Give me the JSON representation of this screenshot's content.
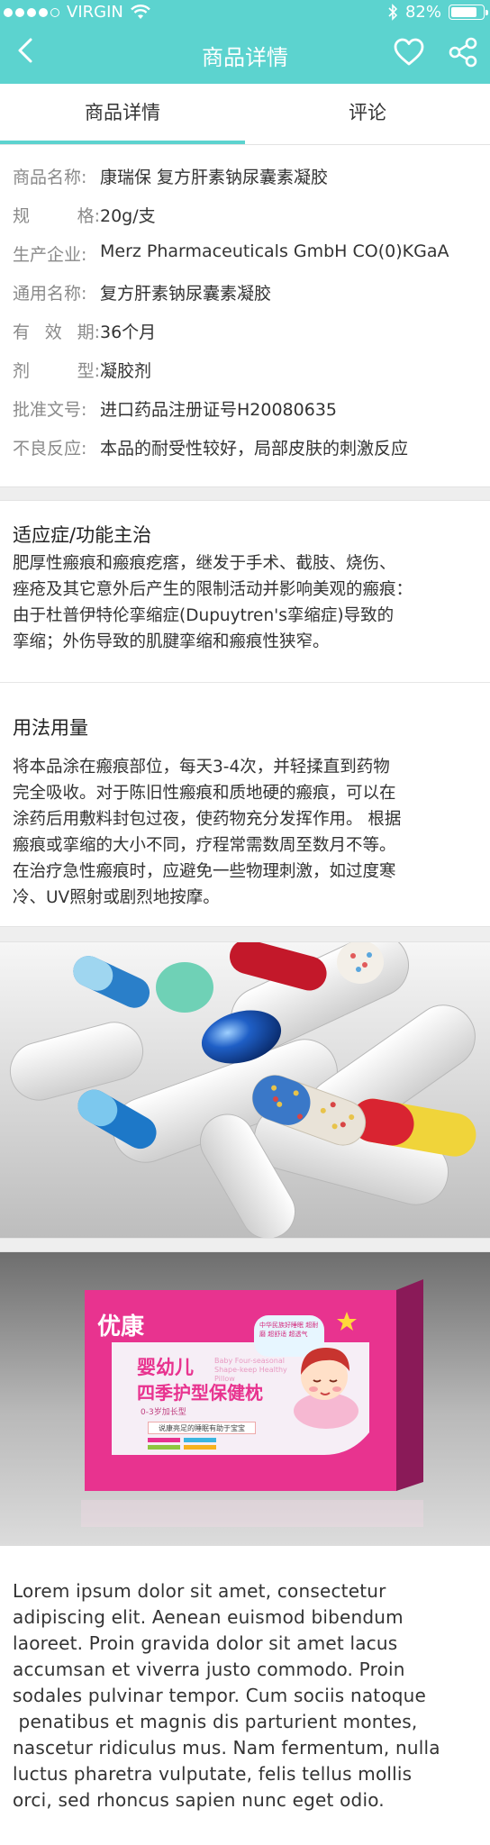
{
  "status_bar": {
    "carrier": "VIRGIN",
    "battery": "82%",
    "battery_level": 0.82
  },
  "nav": {
    "title": "商品详情",
    "icons": [
      "back-arrow-icon",
      "heart-icon",
      "share-icon"
    ]
  },
  "tabs": [
    {
      "label": "商品详情",
      "active": true
    },
    {
      "label": "评论",
      "active": false
    }
  ],
  "product_info": [
    {
      "key_chars": [
        "商品名称:"
      ],
      "value": "康瑞保 复方肝素钠尿囊素凝胶"
    },
    {
      "key_chars": [
        "规",
        "格:"
      ],
      "value": "20g/支"
    },
    {
      "key_chars": [
        "生产企业:"
      ],
      "value": "Merz Pharmaceuticals GmbH CO(0)KGaA"
    },
    {
      "key_chars": [
        "通用名称:"
      ],
      "value": "复方肝素钠尿囊素凝胶"
    },
    {
      "key_chars": [
        "有",
        "效",
        "期:"
      ],
      "value": "36个月"
    },
    {
      "key_chars": [
        "剂",
        "型:"
      ],
      "value": "凝胶剂"
    },
    {
      "key_chars": [
        "批准文号:"
      ],
      "value": "进口药品注册证号H20080635"
    },
    {
      "key_chars": [
        "不良反应:"
      ],
      "value": "本品的耐受性较好，局部皮肤的刺激反应"
    }
  ],
  "indications": {
    "title": "适应症/功能主治",
    "lines": [
      "肥厚性瘢痕和瘢痕疙瘩，继发于手术、截肢、烧伤、",
      "痤疮及其它意外后产生的限制活动并影响美观的瘢痕：",
      "由于杜普伊特伦挛缩症(Dupuytren's挛缩症)导致的",
      "挛缩；外伤导致的肌腱挛缩和瘢痕性狭窄。"
    ]
  },
  "usage": {
    "title": "用法用量",
    "lines": [
      "将本品涂在瘢痕部位，每天3-4次，并轻揉直到药物",
      "完全吸收。对于陈旧性瘢痕和质地硬的瘢痕，可以在",
      "涂药后用敷料封包过夜，使药物充分发挥作用。 根据",
      "瘢痕或挛缩的大小不同，疗程常需数周至数月不等。",
      "在治疗急性瘢痕时，应避免一些物理刺激，如过度寒",
      "冷、UV照射或剧烈地按摩。"
    ]
  },
  "package_art": {
    "brand": "优康",
    "name_line1": "婴幼儿",
    "name_line2": "四季护型保健枕",
    "subtitle_en": "Baby Four-seasonal Shape-keep Healthy Pillow",
    "age": "0-3岁加长型",
    "banner": "说康亮足的睡眠有助于宝宝",
    "badge": "中华民族好睡眠 超耐磨 超舒适 超透气"
  },
  "lorem": [
    "Lorem ipsum dolor sit amet, consectetur",
    "adipiscing elit. Aenean euismod bibendum",
    "laoreet. Proin gravida dolor sit amet lacus",
    "accumsan et viverra justo commodo. Proin",
    "sodales pulvinar tempor. Cum sociis natoque",
    " penatibus et magnis dis parturient montes,",
    "nascetur ridiculus mus. Nam fermentum, nulla",
    "luctus pharetra vulputate, felis tellus mollis",
    "orci, sed rhoncus sapien nunc eget odio."
  ],
  "colors": {
    "accent": "#5cd3cf",
    "package_pink": "#e8338f"
  }
}
